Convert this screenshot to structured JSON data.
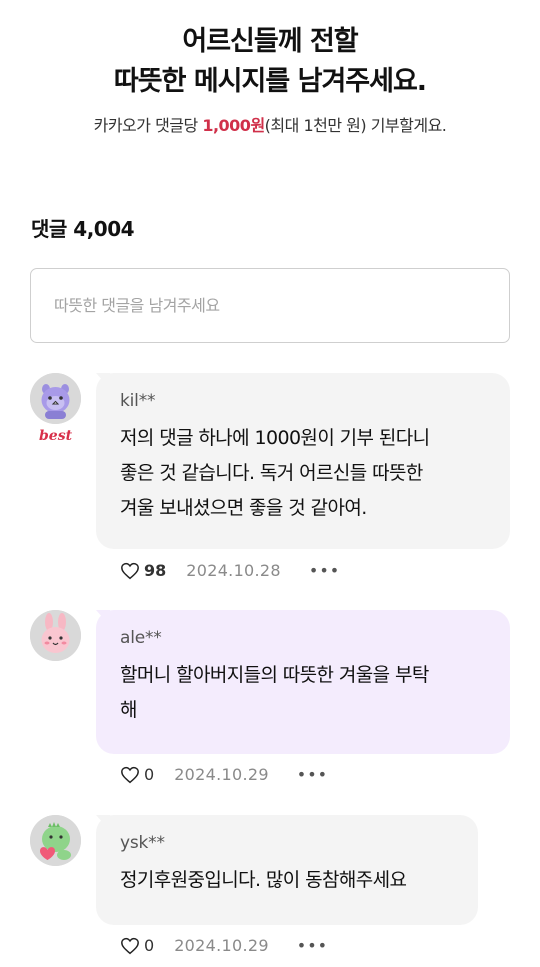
{
  "header": {
    "title_line1": "어르신들께 전할",
    "title_line2": "따뜻한 메시지를 남겨주세요.",
    "subtitle_prefix": "카카오가 댓글당 ",
    "subtitle_amount": "1,000원",
    "subtitle_suffix": "(최대 1천만 원) 기부할게요."
  },
  "comments_header": {
    "label": "댓글",
    "count": "4,004"
  },
  "input": {
    "placeholder": "따뜻한 댓글을 남겨주세요"
  },
  "comments": [
    {
      "author": "kil**",
      "badge": "best",
      "text": "저의 댓글 하나에 1000원이 기부 된다니\n좋은 것 같습니다. 독거 어르신들 따뜻한\n겨울 보내셨으면 좋을 것 같아여.",
      "likes": "98",
      "date": "2024.10.28",
      "more": "•••",
      "avatar_icon": "purple-character-icon",
      "bubble_color": "#f4f4f4"
    },
    {
      "author": "ale**",
      "text": "할머니 할아버지들의 따뜻한 겨울을 부탁\n해",
      "likes": "0",
      "date": "2024.10.29",
      "more": "•••",
      "avatar_icon": "pink-bunny-icon",
      "bubble_color": "#f4ecfd"
    },
    {
      "author": "ysk**",
      "text": "정기후원중입니다. 많이 동참해주세요",
      "likes": "0",
      "date": "2024.10.29",
      "more": "•••",
      "avatar_icon": "green-dinosaur-icon",
      "bubble_color": "#f4f4f4"
    }
  ],
  "colors": {
    "accent": "#d0304a",
    "best_badge": "#d8304a"
  }
}
